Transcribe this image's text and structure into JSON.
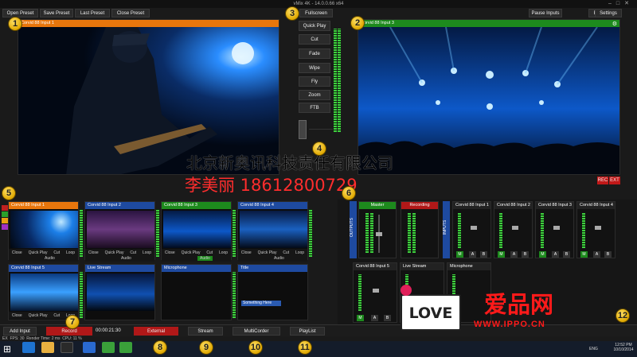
{
  "window": {
    "title": "vMix 4K - 14.0.0.66 x64"
  },
  "top_left_buttons": [
    "Open Preset",
    "Save Preset",
    "Last Preset",
    "Close Preset"
  ],
  "top_right_buttons": [
    "Pause Inputs",
    "Basic",
    "Settings"
  ],
  "fullscreen_label": "Fullscreen",
  "preview": {
    "title": "Corvid 88 Input 1"
  },
  "output": {
    "title": "Corvid 88 Input 3"
  },
  "transitions": [
    "Quick Play",
    "Cut",
    "Fade",
    "Wipe",
    "Fly",
    "Zoom",
    "FTB"
  ],
  "watermark": {
    "company": "北京新奥讯科技责任有限公司",
    "contact": "李美丽  18612800729"
  },
  "rec_buttons": [
    "REC",
    "EXT"
  ],
  "inputs": [
    {
      "title": "Corvid 88 Input 1",
      "bar": "#e8760c"
    },
    {
      "title": "Corvid 88 Input 2",
      "bar": "#1e4aa0"
    },
    {
      "title": "Corvid 88 Input 3",
      "bar": "#1d8a1d"
    },
    {
      "title": "Corvid 88 Input 4",
      "bar": "#1e4aa0"
    },
    {
      "title": "Corvid 88 Input 5",
      "bar": "#1e4aa0"
    },
    {
      "title": "Live Stream",
      "bar": "#1e4aa0"
    },
    {
      "title": "Microphone",
      "bar": "#1e4aa0"
    },
    {
      "title": "Title",
      "bar": "#1e4aa0"
    }
  ],
  "input_controls": [
    "Close",
    "Quick Play",
    "Cut",
    "Loop",
    "Audio"
  ],
  "title_card_text": "Something Here",
  "audio": {
    "outputs_label": "OUTPUTS",
    "inputs_label": "INPUTS",
    "master_label": "Master",
    "recording_label": "Recording",
    "channels_top": [
      "Corvid 88 Input 1",
      "Corvid 88 Input 2",
      "Corvid 88 Input 3",
      "Corvid 88 Input 4"
    ],
    "channels_bottom": [
      "Corvid 88 Input 5",
      "Live Stream",
      "Microphone"
    ],
    "buttons": [
      "M",
      "A",
      "B"
    ]
  },
  "bottom_bar": {
    "add_input": "Add Input",
    "record": "Record",
    "record_time": "00:00:21:30",
    "external": "External",
    "stream": "Stream",
    "multicorder": "MultiCorder",
    "playlist": "PlayList"
  },
  "status": {
    "text": "EX  FPS: 30  Render Time: 2 ms  CPU: 11 %"
  },
  "taskbar": {
    "time": "12:52 PM",
    "date": "10/10/2014",
    "lang": "ENG"
  },
  "logo": {
    "love": "LOVE",
    "brand": "爱品网",
    "url": "WWW.IPPO.CN"
  },
  "badges": [
    "1",
    "2",
    "3",
    "4",
    "5",
    "6",
    "7",
    "8",
    "9",
    "10",
    "11",
    "12"
  ]
}
